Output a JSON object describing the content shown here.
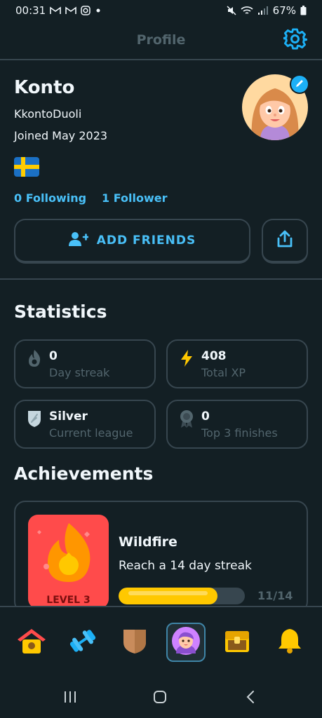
{
  "status_bar": {
    "time": "00:31",
    "battery": "67%"
  },
  "header": {
    "title": "Profile"
  },
  "profile": {
    "name": "Konto",
    "username": "KkontoDuoli",
    "joined": "Joined May 2023",
    "following": "0 Following",
    "followers": "1 Follower",
    "add_friends_label": "ADD FRIENDS"
  },
  "statistics": {
    "title": "Statistics",
    "cards": [
      {
        "icon": "flame-icon",
        "value": "0",
        "label": "Day streak"
      },
      {
        "icon": "lightning-icon",
        "value": "408",
        "label": "Total XP"
      },
      {
        "icon": "silver-league-shield-icon",
        "value": "Silver",
        "label": "Current league"
      },
      {
        "icon": "medal-icon",
        "value": "0",
        "label": "Top 3 finishes"
      }
    ]
  },
  "achievements": {
    "title": "Achievements",
    "items": [
      {
        "title": "Wildfire",
        "description": "Reach a 14 day streak",
        "level": "LEVEL 3",
        "progress_text": "11/14",
        "progress": 0.786
      }
    ]
  },
  "colors": {
    "accent": "#49c0f8",
    "background": "#131f24",
    "border": "#37464f",
    "muted": "#52656d",
    "badge_red": "#ff4b4b",
    "progress_yellow": "#ffc800"
  },
  "bottom_nav": {
    "items": [
      {
        "icon": "home-birdhouse-icon",
        "active": false
      },
      {
        "icon": "dumbbell-icon",
        "active": false
      },
      {
        "icon": "league-shield-icon",
        "active": false
      },
      {
        "icon": "profile-avatar-icon",
        "active": true
      },
      {
        "icon": "treasure-chest-icon",
        "active": false
      },
      {
        "icon": "bell-icon",
        "active": false
      }
    ]
  }
}
